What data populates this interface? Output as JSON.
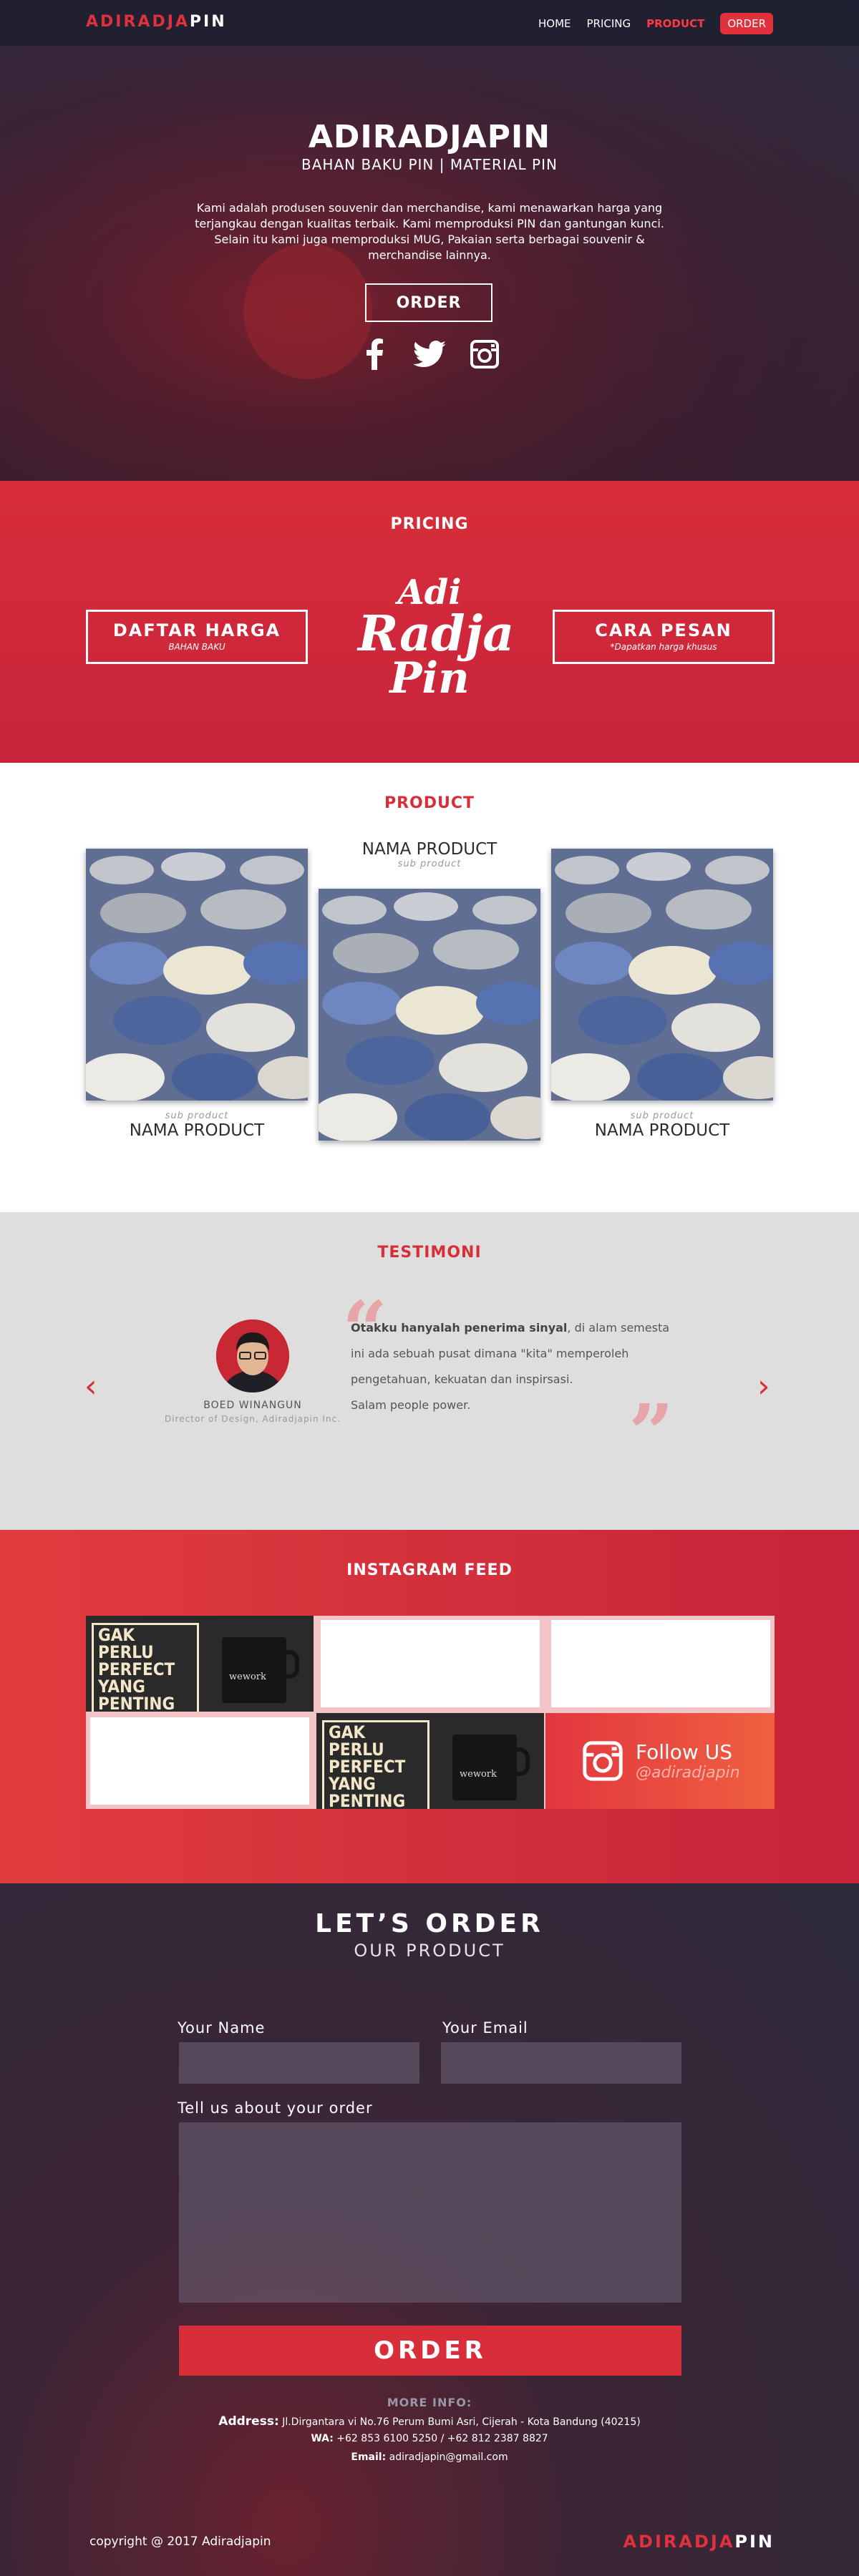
{
  "nav": {
    "logo_part1": "ADIRADJA",
    "logo_part2": "PIN",
    "links": [
      "HOME",
      "PRICING",
      "PRODUCT",
      "ORDER"
    ]
  },
  "hero": {
    "title": "ADIRADJAPIN",
    "subtitle": "BAHAN BAKU PIN | MATERIAL PIN",
    "description": "Kami adalah produsen souvenir dan merchandise, kami menawarkan harga yang terjangkau dengan kualitas terbaik. Kami memproduksi PIN dan gantungan kunci. Selain itu kami juga memproduksi MUG, Pakaian serta berbagai souvenir & merchandise lainnya.",
    "button": "ORDER",
    "socials": [
      "facebook-icon",
      "twitter-icon",
      "instagram-icon"
    ]
  },
  "pricing": {
    "title": "PRICING",
    "left_title": "DAFTAR HARGA",
    "left_sub": "BAHAN BAKU",
    "right_title": "CARA PESAN",
    "right_sub": "*Dapatkan harga khusus",
    "logo_l1": "Adi",
    "logo_l2": "Radja",
    "logo_l3": "Pin"
  },
  "product": {
    "title": "PRODUCT",
    "items": [
      {
        "sub": "sub product",
        "name": "NAMA PRODUCT"
      },
      {
        "sub": "sub product",
        "name": "NAMA PRODUCT"
      },
      {
        "sub": "sub product",
        "name": "NAMA PRODUCT"
      }
    ]
  },
  "testimoni": {
    "title": "TESTIMONI",
    "name": "BOED WINANGUN",
    "role": "Director of Design, Adiradjapin Inc.",
    "quote_bold": "Otakku hanyalah penerima sinyal",
    "quote_rest": ", di alam semesta ini ada sebuah pusat dimana \"kita\" memperoleh pengetahuan, kekuatan dan inspirsasi.",
    "quote_last": "Salam people power.",
    "prev": "‹",
    "next": "›"
  },
  "instagram": {
    "title": "INSTAGRAM FEED",
    "mug_text": "GAK PERLU PERFECT YANG PENTING RESPECT",
    "mug_brand": "wework",
    "follow": "Follow US",
    "handle": "@adiradjapin"
  },
  "order": {
    "title": "LET’S ORDER",
    "subtitle": "OUR PRODUCT",
    "name_label": "Your Name",
    "email_label": "Your Email",
    "message_label": "Tell us about your order",
    "button": "ORDER",
    "more_info": "MORE INFO:",
    "address_label": "Address:",
    "address": "Jl.Dirgantara vi No.76 Perum Bumi Asri, Cijerah - Kota Bandung (40215)",
    "wa_label": "WA:",
    "wa": "+62 853 6100 5250 / +62 812 2387 8827",
    "email_label2": "Email:",
    "email": "adiradjapin@gmail.com"
  },
  "footer": {
    "copyright": "copyright @ 2017 Adiradjapin",
    "logo_part1": "ADIRADJA",
    "logo_part2": "PIN"
  },
  "colors": {
    "accent": "#d82e3a",
    "dark": "#2b2b3d",
    "gray": "#dedede"
  }
}
